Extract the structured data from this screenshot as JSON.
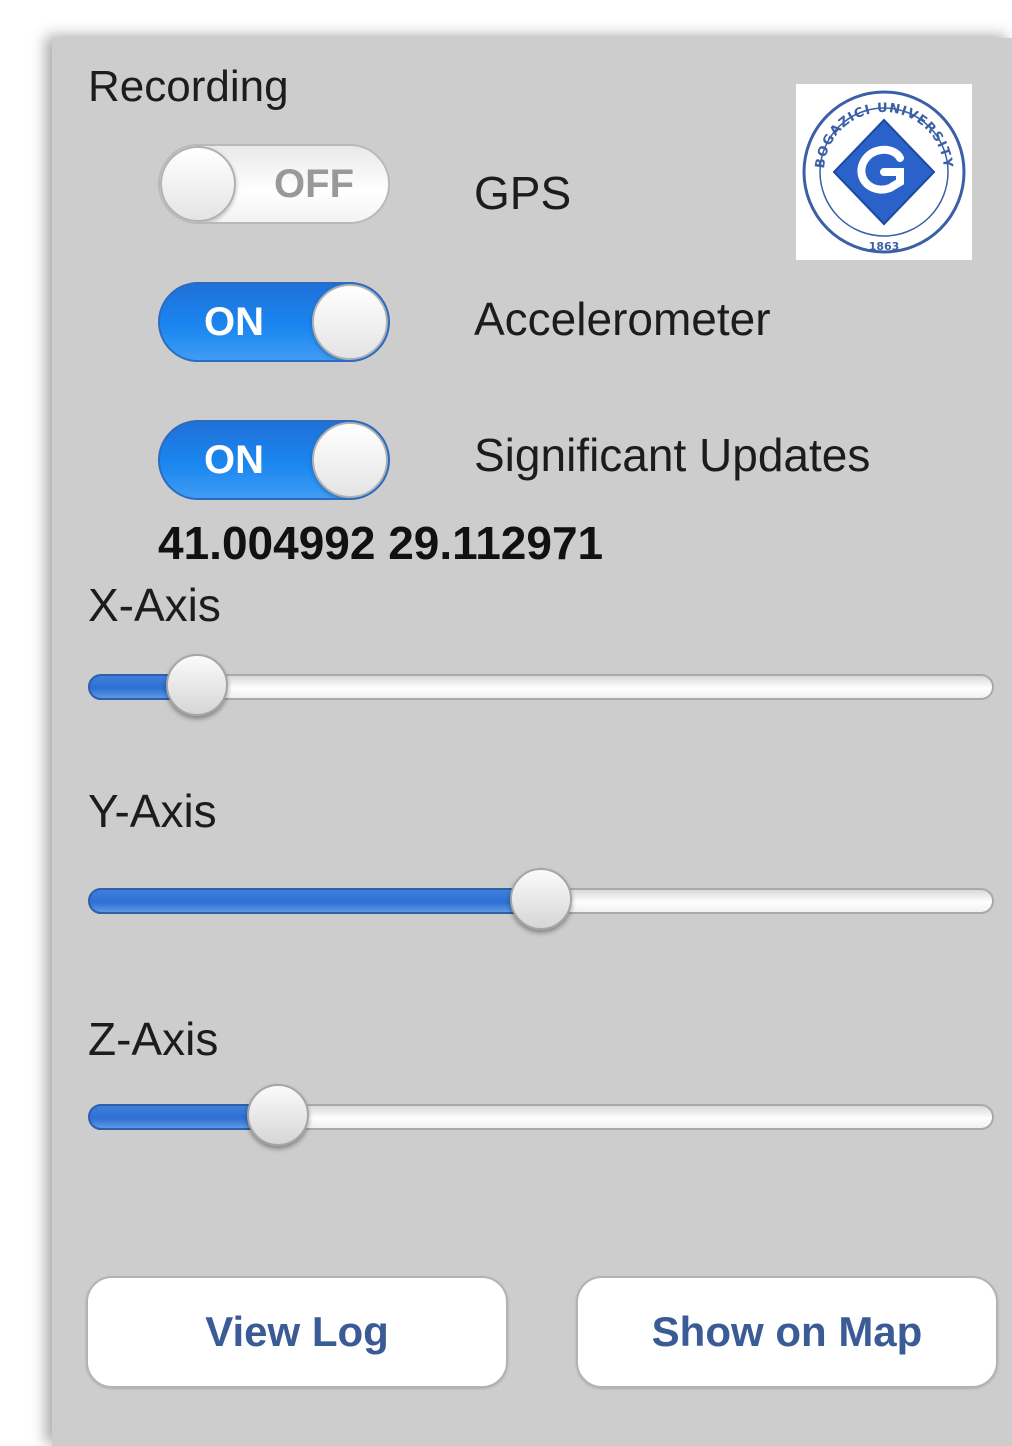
{
  "recording": {
    "title": "Recording",
    "toggles": [
      {
        "label": "GPS",
        "state_text": "OFF",
        "on": false
      },
      {
        "label": "Accelerometer",
        "state_text": "ON",
        "on": true
      },
      {
        "label": "Significant Updates",
        "state_text": "ON",
        "on": true
      }
    ]
  },
  "logo": {
    "text": "BOGAZICI UNIVERSITY",
    "year": "1863",
    "accent": "#2a62c9"
  },
  "coordinates": "41.004992 29.112971",
  "axes": [
    {
      "label": "X-Axis",
      "value_fraction": 0.12
    },
    {
      "label": "Y-Axis",
      "value_fraction": 0.5
    },
    {
      "label": "Z-Axis",
      "value_fraction": 0.21
    }
  ],
  "buttons": {
    "view_log": "View Log",
    "show_on_map": "Show on Map"
  },
  "colors": {
    "toggle_on": "#1a86f0",
    "slider_fill": "#2d6fd3",
    "button_text": "#3a5b95",
    "panel_bg": "#cdcdcd"
  }
}
